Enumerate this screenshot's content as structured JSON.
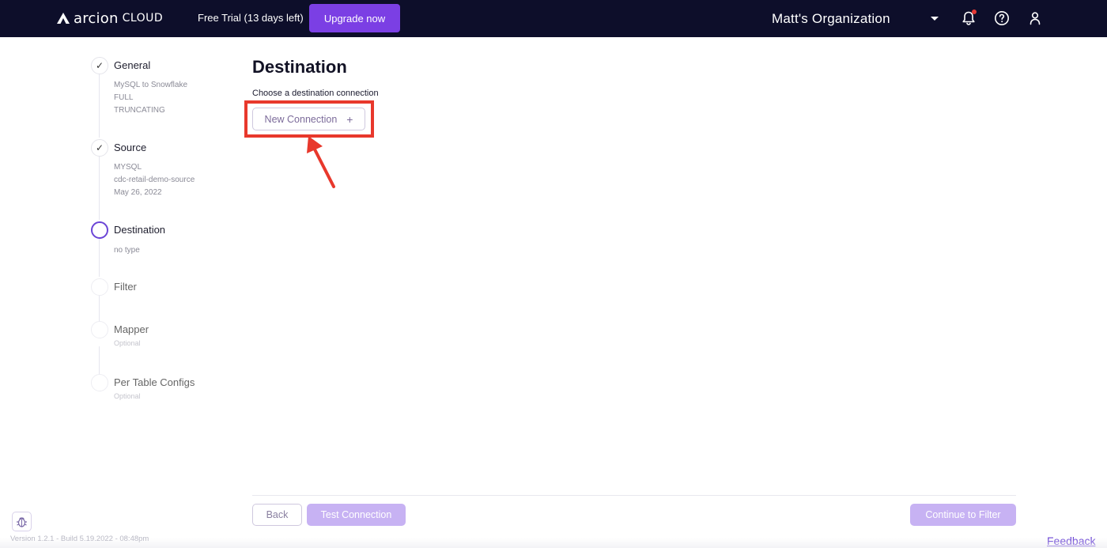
{
  "header": {
    "logo_word": "arcion",
    "logo_suffix": "CLOUD",
    "trial_text": "Free Trial (13 days left)",
    "upgrade_label": "Upgrade now",
    "org_name": "Matt's Organization",
    "icons": [
      "bell-icon",
      "help-icon",
      "user-icon"
    ]
  },
  "stepper": {
    "steps": [
      {
        "title": "General",
        "status": "completed",
        "details": [
          "MySQL to Snowflake",
          "FULL",
          "TRUNCATING"
        ]
      },
      {
        "title": "Source",
        "status": "completed",
        "details": [
          "MYSQL",
          "cdc-retail-demo-source",
          "May 26, 2022"
        ]
      },
      {
        "title": "Destination",
        "status": "current",
        "details": [
          "no type"
        ]
      },
      {
        "title": "Filter",
        "status": "pending",
        "details": []
      },
      {
        "title": "Mapper",
        "status": "pending",
        "details": [
          "Optional"
        ]
      },
      {
        "title": "Per Table Configs",
        "status": "pending",
        "details": [
          "Optional"
        ]
      }
    ]
  },
  "main": {
    "title": "Destination",
    "choose_label": "Choose a destination connection",
    "new_connection_label": "New Connection",
    "new_connection_icon": "+"
  },
  "footer": {
    "back_label": "Back",
    "test_label": "Test Connection",
    "continue_label": "Continue to Filter",
    "version": "Version 1.2.1 - Build 5.19.2022 - 08:48pm",
    "feedback": "Feedback"
  },
  "colors": {
    "topbar": "#0d0e2a",
    "accent": "#7b3fe4",
    "disabled_button": "#c7b2f3",
    "annotation": "#e8382c"
  }
}
